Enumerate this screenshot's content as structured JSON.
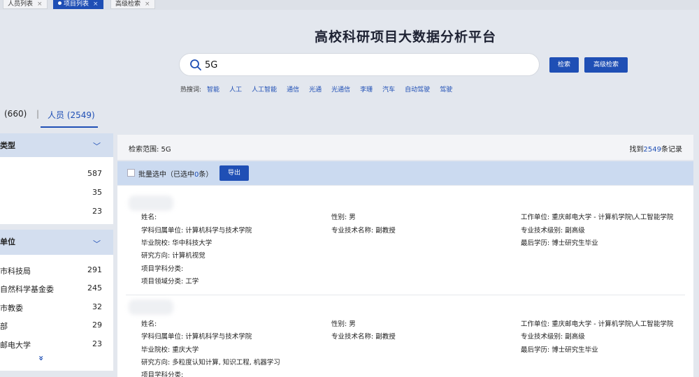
{
  "tabs": [
    {
      "label": "人员列表",
      "close": "×"
    },
    {
      "label": "项目列表",
      "close": "×"
    },
    {
      "label": "高级检索",
      "close": "×"
    }
  ],
  "header": {
    "title": "高校科研项目大数据分析平台",
    "search_value": "5G",
    "search_btn": "检索",
    "adv_btn": "高级检索"
  },
  "hot": {
    "label": "热搜词:",
    "keywords": [
      "智能",
      "人工",
      "人工智能",
      "通信",
      "光通",
      "光通信",
      "李珊",
      "汽车",
      "自动驾驶",
      "驾驶"
    ]
  },
  "result_tabs": {
    "count": "(660)",
    "sep": "|",
    "people": "人员 (2549)"
  },
  "sidebar": {
    "box1": {
      "title": "类型",
      "items": [
        {
          "name": "",
          "count": "587"
        },
        {
          "name": "",
          "count": "35"
        },
        {
          "name": "",
          "count": "23"
        }
      ]
    },
    "box2": {
      "title": "单位",
      "items": [
        {
          "name": "市科技局",
          "count": "291"
        },
        {
          "name": "自然科学基金委",
          "count": "245"
        },
        {
          "name": "市教委",
          "count": "32"
        },
        {
          "name": "部",
          "count": "29"
        },
        {
          "name": "邮电大学",
          "count": "23"
        }
      ]
    },
    "more": "»"
  },
  "scope": {
    "label": "检索范围: 5G",
    "found_prefix": "找到",
    "found_count": "2549",
    "found_suffix": "条记录"
  },
  "batch": {
    "prefix": "批量选中（已选中",
    "count": "0",
    "suffix": "条）",
    "export_btn": "导出"
  },
  "results": [
    {
      "name": "姓名:",
      "gender": "性别: 男",
      "unit": "工作单位: 重庆邮电大学 - 计算机学院\\人工智能学院",
      "dept": "学科归属单位: 计算机科学与技术学院",
      "title": "专业技术名称: 副教授",
      "level": "专业技术级别: 副高级",
      "school": "毕业院校: 华中科技大学",
      "degree": "最后学历: 博士研究生毕业",
      "field": "研究方向: 计算机视觉",
      "subject": "项目学科分类:",
      "domain": "项目领域分类: 工学"
    },
    {
      "name": "姓名:",
      "gender": "性别: 男",
      "unit": "工作单位: 重庆邮电大学 - 计算机学院\\人工智能学院",
      "dept": "学科归属单位: 计算机科学与技术学院",
      "title": "专业技术名称: 副教授",
      "level": "专业技术级别: 副高级",
      "school": "毕业院校: 重庆大学",
      "degree": "最后学历: 博士研究生毕业",
      "field": "研究方向: 多粒度认知计算, 知识工程, 机器学习",
      "subject": "项目学科分类:"
    }
  ],
  "colors": {
    "accent": "#1f4fb5",
    "header_bar": "#cbdaf0"
  }
}
